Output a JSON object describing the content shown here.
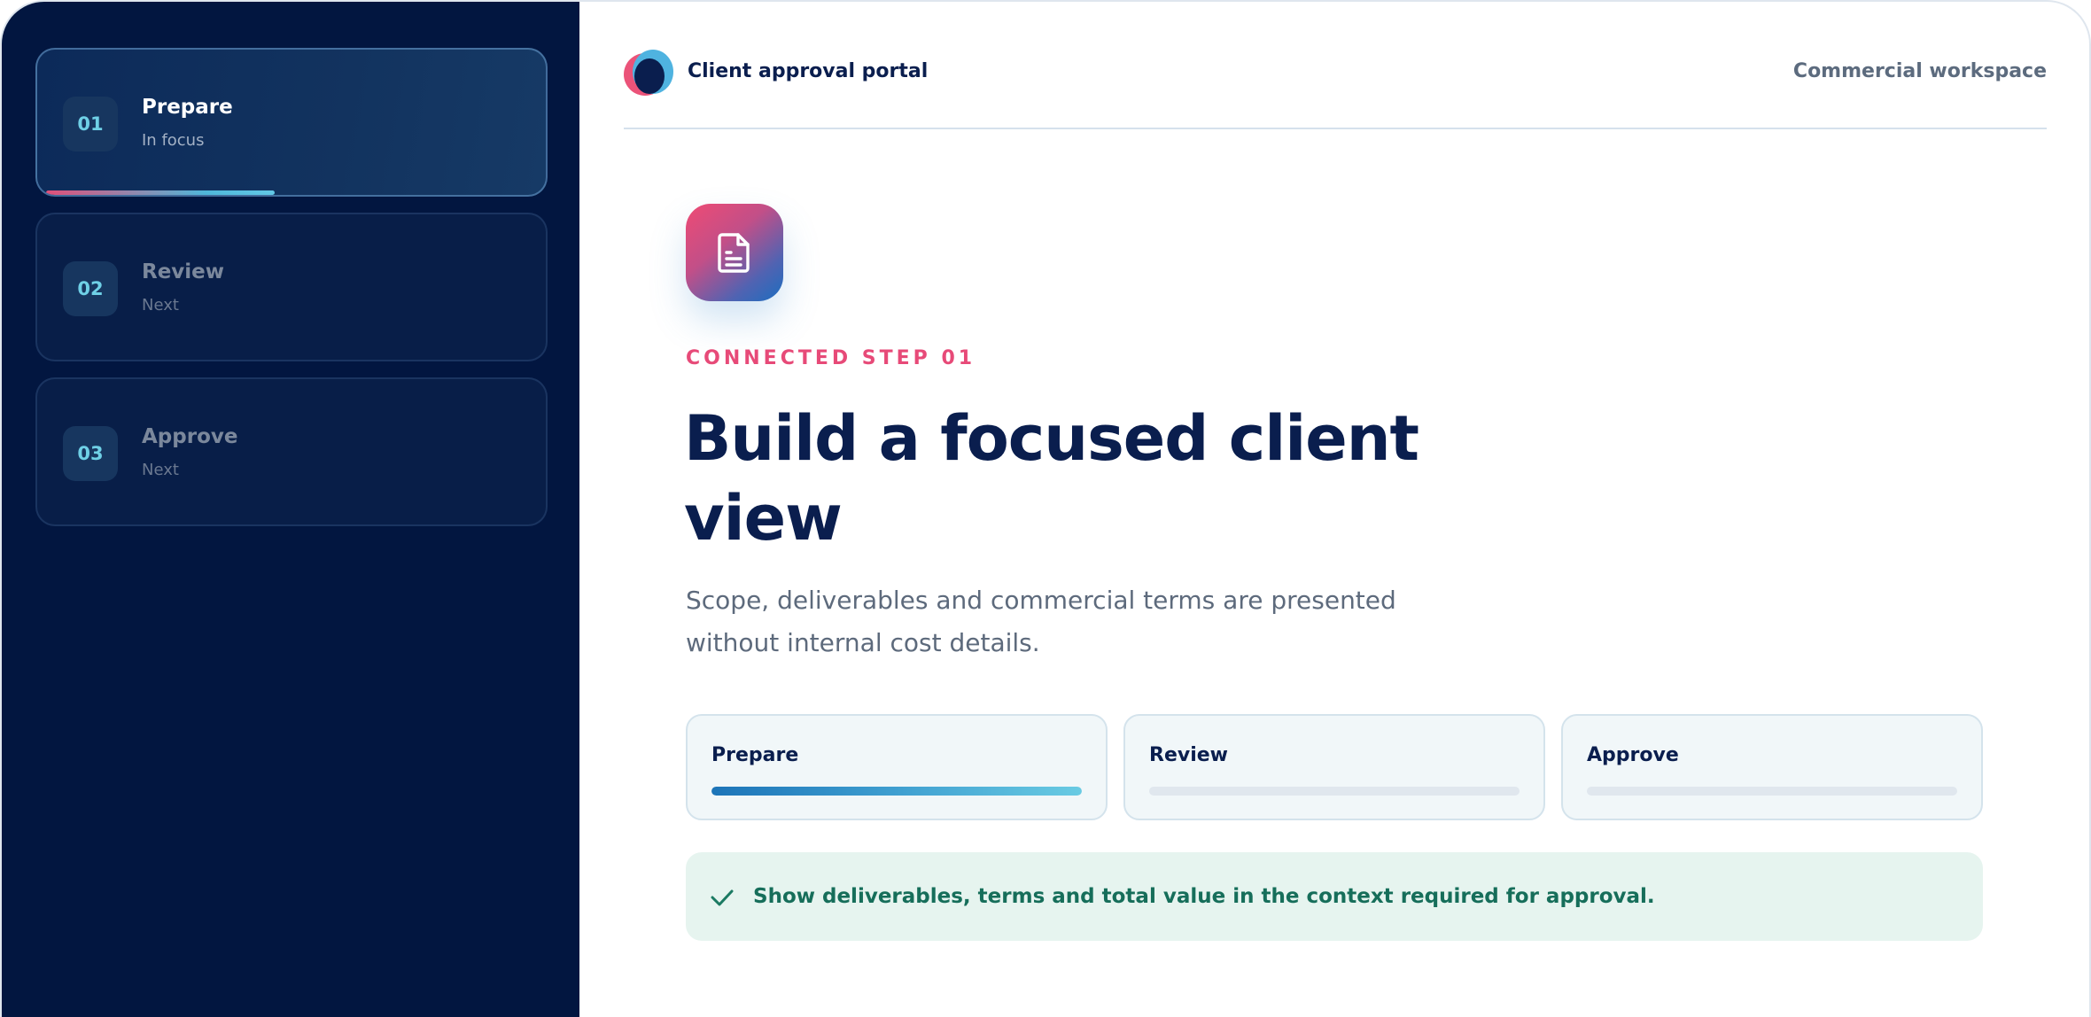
{
  "sidebar": {
    "steps": [
      {
        "number": "01",
        "title": "Prepare",
        "status": "In focus",
        "progress": 0.45
      },
      {
        "number": "02",
        "title": "Review",
        "status": "Next"
      },
      {
        "number": "03",
        "title": "Approve",
        "status": "Next"
      }
    ]
  },
  "header": {
    "brand": "Client approval portal",
    "workspace": "Commercial workspace"
  },
  "content": {
    "icon": "document-icon",
    "eyebrow": "CONNECTED STEP 01",
    "title": "Build a focused client view",
    "description": "Scope, deliverables and commercial terms are presented without internal cost details.",
    "stages": [
      {
        "label": "Prepare",
        "progress": 1.0
      },
      {
        "label": "Review",
        "progress": 0
      },
      {
        "label": "Approve",
        "progress": 0
      }
    ],
    "note": {
      "icon": "check-icon",
      "text": "Show deliverables, terms and total value in the context required for approval."
    }
  },
  "colors": {
    "sidebar_bg": "#021640",
    "accent_pink": "#e74a78",
    "accent_blue": "#1c74b8",
    "heading": "#0a1e4e",
    "success_text": "#166e5a",
    "success_bg": "#e6f4ef"
  }
}
